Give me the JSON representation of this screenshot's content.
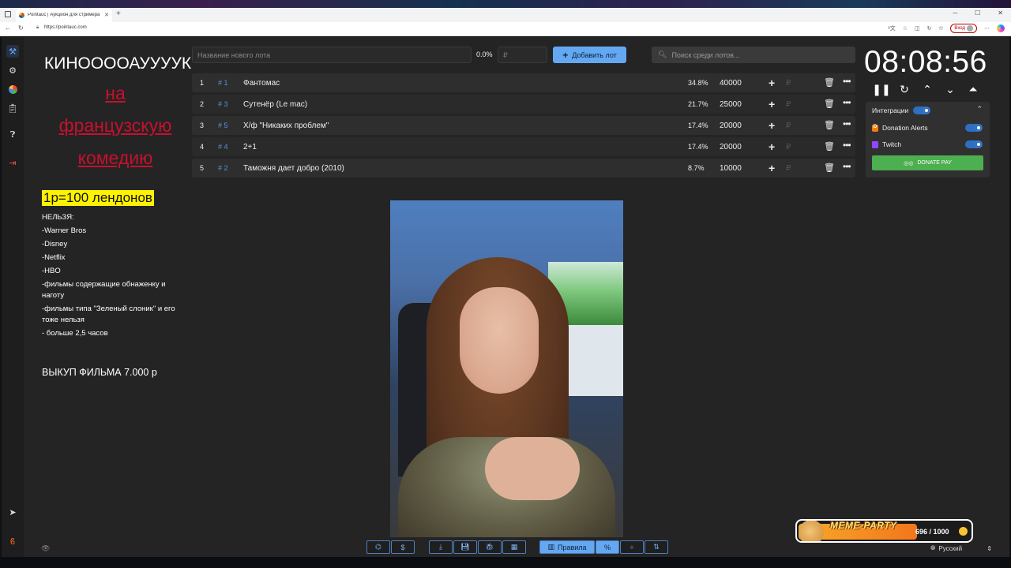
{
  "browser": {
    "tab_title": "Pointauc | Аукцион для стримера",
    "url": "https://pointauc.com",
    "signin_label": "Вход"
  },
  "sidebar": {
    "icons": [
      "gavel-icon",
      "gear-icon",
      "pie-chart-icon",
      "clipboard-icon",
      "help-icon",
      "logout-icon",
      "telegram-icon",
      "boosty-icon"
    ]
  },
  "rules": {
    "title_line1": "КИНООООАУУУУК",
    "title_line2": "на",
    "title_line3": "французскую",
    "title_line4": "комедию",
    "rate": "1р=100 лендонов",
    "forbidden_header": "НЕЛЬЗЯ:",
    "items": [
      "-Warner Bros",
      "-Disney",
      "-Netflix",
      "-HBO",
      "-фильмы содержащие обнаженку и наготу",
      "-фильмы типа \"Зеленый слоник\" и его тоже нельзя",
      "- больше 2,5 часов"
    ],
    "buyout": "ВЫКУП ФИЛЬМА 7.000 р"
  },
  "controls": {
    "new_lot_placeholder": "Название нового лота",
    "percent": "0.0%",
    "amount_placeholder": "₽",
    "add_button": "Добавить лот",
    "search_placeholder": "Поиск среди лотов..."
  },
  "lots": [
    {
      "num": "1",
      "id": "# 1",
      "name": "Фантомас",
      "pct": "34.8%",
      "amount": "40000"
    },
    {
      "num": "2",
      "id": "# 3",
      "name": "Сутенёр (Le mac)",
      "pct": "21.7%",
      "amount": "25000"
    },
    {
      "num": "3",
      "id": "# 5",
      "name": "Х/ф \"Никаких проблем\"",
      "pct": "17.4%",
      "amount": "20000"
    },
    {
      "num": "4",
      "id": "# 4",
      "name": "2+1",
      "pct": "17.4%",
      "amount": "20000"
    },
    {
      "num": "5",
      "id": "# 2",
      "name": "Таможня дает добро (2010)",
      "pct": "8.7%",
      "amount": "10000"
    }
  ],
  "timer": {
    "value": "08:08:56"
  },
  "integrations": {
    "title": "Интеграции",
    "enabled": true,
    "items": [
      {
        "name": "Donation Alerts",
        "enabled": true
      },
      {
        "name": "Twitch",
        "enabled": true
      }
    ],
    "donatepay_button": "DONATE PAY"
  },
  "footer": {
    "rules_button": "Правила",
    "percent_symbol": "%"
  },
  "meme_party": {
    "title": "MEME-PARTY",
    "counter": "696 / 1000"
  },
  "language": {
    "selected": "Русский"
  },
  "colors": {
    "accent": "#64a8f2",
    "rules_red": "#c8102e",
    "highlight": "#fff200",
    "donatepay": "#4caf50"
  }
}
